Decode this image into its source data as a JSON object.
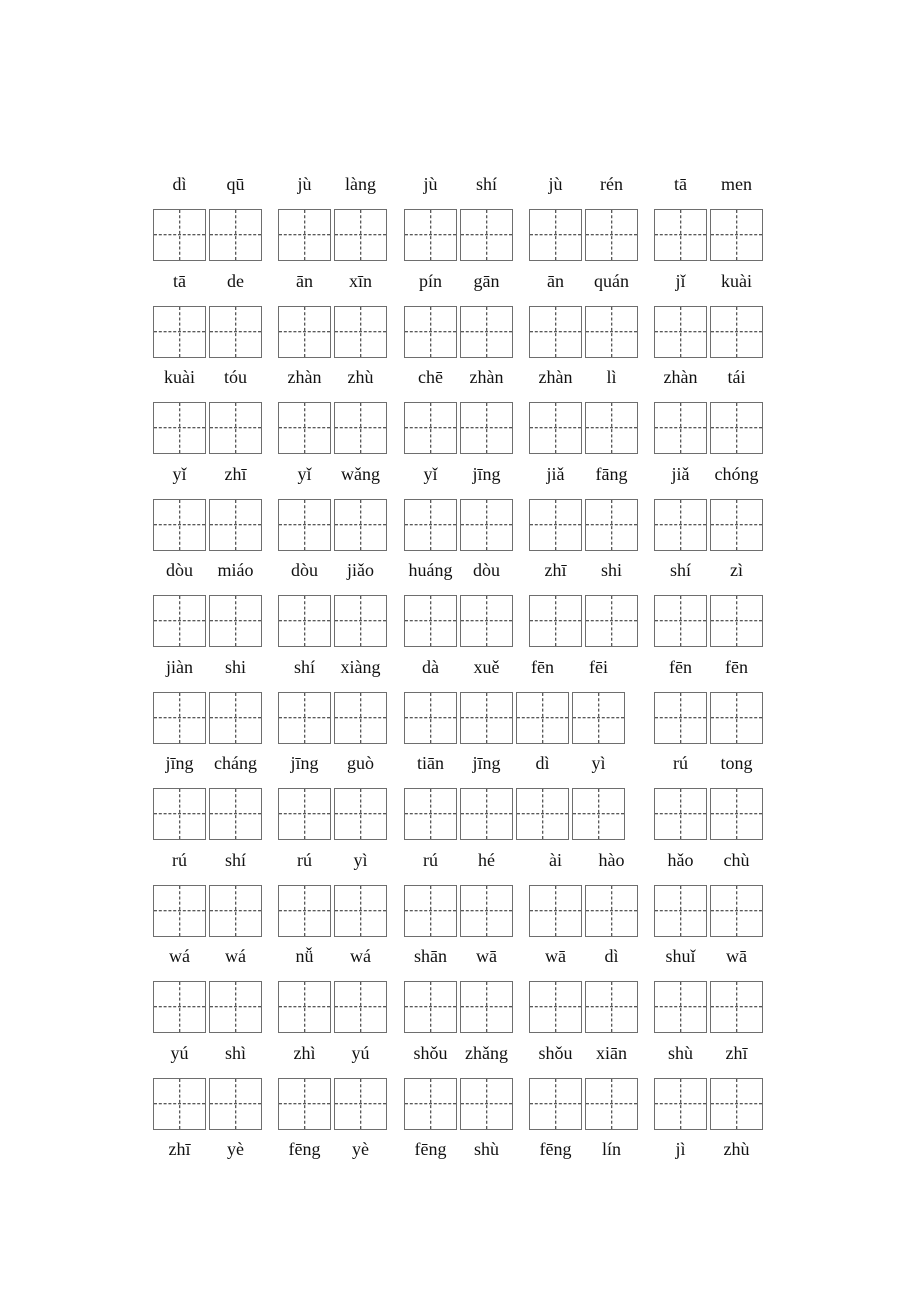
{
  "worksheet": {
    "rows": [
      {
        "words": [
          [
            "dì",
            "qū"
          ],
          [
            "jù",
            "làng"
          ],
          [
            "jù",
            "shí"
          ],
          [
            "jù",
            "rén"
          ],
          [
            "tā",
            "men"
          ]
        ]
      },
      {
        "words": [
          [
            "tā",
            "de"
          ],
          [
            "ān",
            "xīn"
          ],
          [
            "pín",
            "gān"
          ],
          [
            "ān",
            "quán"
          ],
          [
            "jǐ",
            "kuài"
          ]
        ]
      },
      {
        "words": [
          [
            "kuài",
            "tóu"
          ],
          [
            "zhàn",
            "zhù"
          ],
          [
            "chē",
            "zhàn"
          ],
          [
            "zhàn",
            "lì"
          ],
          [
            "zhàn",
            "tái"
          ]
        ]
      },
      {
        "words": [
          [
            "yǐ",
            "zhī"
          ],
          [
            "yǐ",
            "wǎng"
          ],
          [
            "yǐ",
            "jīng"
          ],
          [
            "jiǎ",
            "fāng"
          ],
          [
            "jiǎ",
            "chóng"
          ]
        ]
      },
      {
        "words": [
          [
            "dòu",
            "miáo"
          ],
          [
            "dòu",
            "jiǎo"
          ],
          [
            "huáng",
            "dòu"
          ],
          [
            "zhī",
            "shi"
          ],
          [
            "shí",
            "zì"
          ]
        ]
      },
      {
        "words": [
          [
            "jiàn",
            "shi"
          ],
          [
            "shí",
            "xiàng"
          ],
          [
            "dà",
            "xuě",
            "fēn",
            "fēi"
          ],
          [
            "fēn",
            "fēn"
          ]
        ]
      },
      {
        "words": [
          [
            "jīng",
            "cháng"
          ],
          [
            "jīng",
            "guò"
          ],
          [
            "tiān",
            "jīng",
            "dì",
            "yì"
          ],
          [
            "rú",
            "tong"
          ]
        ]
      },
      {
        "words": [
          [
            "rú",
            "shí"
          ],
          [
            "rú",
            "yì"
          ],
          [
            "rú",
            "hé"
          ],
          [
            "ài",
            "hào"
          ],
          [
            "hǎo",
            "chù"
          ]
        ]
      },
      {
        "words": [
          [
            "wá",
            "wá"
          ],
          [
            "nǚ",
            "wá"
          ],
          [
            "shān",
            "wā"
          ],
          [
            "wā",
            "dì"
          ],
          [
            "shuǐ",
            "wā"
          ]
        ]
      },
      {
        "words": [
          [
            "yú",
            "shì"
          ],
          [
            "zhì",
            "yú"
          ],
          [
            "shǒu",
            "zhǎng"
          ],
          [
            "shǒu",
            "xiān"
          ],
          [
            "shù",
            "zhī"
          ]
        ]
      },
      {
        "words": [
          [
            "zhī",
            "yè"
          ],
          [
            "fēng",
            "yè"
          ],
          [
            "fēng",
            "shù"
          ],
          [
            "fēng",
            "lín"
          ],
          [
            "jì",
            "zhù"
          ]
        ]
      }
    ],
    "box_rows": [
      {
        "groups": [
          2,
          2,
          2,
          2,
          2
        ]
      },
      {
        "groups": [
          2,
          2,
          2,
          2,
          2
        ]
      },
      {
        "groups": [
          2,
          2,
          2,
          2,
          2
        ]
      },
      {
        "groups": [
          2,
          2,
          2,
          2,
          2
        ]
      },
      {
        "groups": [
          2,
          2,
          2,
          2,
          2
        ]
      },
      {
        "groups": [
          2,
          2,
          4,
          2
        ]
      },
      {
        "groups": [
          2,
          2,
          4,
          2
        ]
      },
      {
        "groups": [
          2,
          2,
          2,
          2,
          2
        ]
      },
      {
        "groups": [
          2,
          2,
          2,
          2,
          2
        ]
      },
      {
        "groups": [
          2,
          2,
          2,
          2,
          2
        ]
      }
    ]
  }
}
